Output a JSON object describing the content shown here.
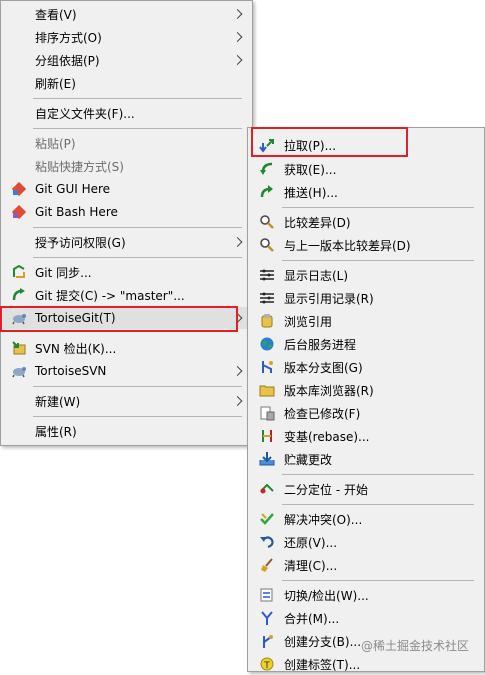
{
  "main_menu": {
    "items": [
      {
        "label": "查看(V)"
      },
      {
        "label": "排序方式(O)"
      },
      {
        "label": "分组依据(P)"
      },
      {
        "label": "刷新(E)"
      },
      {
        "label": "自定义文件夹(F)..."
      },
      {
        "label": "粘贴(P)"
      },
      {
        "label": "粘贴快捷方式(S)"
      },
      {
        "label": "Git GUI Here"
      },
      {
        "label": "Git Bash Here"
      },
      {
        "label": "授予访问权限(G)"
      },
      {
        "label": "Git 同步..."
      },
      {
        "label": "Git 提交(C) -> \"master\"..."
      },
      {
        "label": "TortoiseGit(T)"
      },
      {
        "label": "SVN 检出(K)..."
      },
      {
        "label": "TortoiseSVN"
      },
      {
        "label": "新建(W)"
      },
      {
        "label": "属性(R)"
      }
    ]
  },
  "tortoisegit_submenu": {
    "items": [
      {
        "label": "拉取(P)..."
      },
      {
        "label": "获取(E)..."
      },
      {
        "label": "推送(H)..."
      },
      {
        "label": "比较差异(D)"
      },
      {
        "label": "与上一版本比较差异(D)"
      },
      {
        "label": "显示日志(L)"
      },
      {
        "label": "显示引用记录(R)"
      },
      {
        "label": "浏览引用"
      },
      {
        "label": "后台服务进程"
      },
      {
        "label": "版本分支图(G)"
      },
      {
        "label": "版本库浏览器(R)"
      },
      {
        "label": "检查已修改(F)"
      },
      {
        "label": "变基(rebase)..."
      },
      {
        "label": "贮藏更改"
      },
      {
        "label": "二分定位 - 开始"
      },
      {
        "label": "解决冲突(O)..."
      },
      {
        "label": "还原(V)..."
      },
      {
        "label": "清理(C)..."
      },
      {
        "label": "切换/检出(W)..."
      },
      {
        "label": "合并(M)..."
      },
      {
        "label": "创建分支(B)..."
      },
      {
        "label": "创建标签(T)..."
      }
    ]
  },
  "watermark": "@稀土掘金技术社区",
  "colors": {
    "highlight_box": "#e11f24",
    "menu_bg": "#f0f0f0"
  }
}
